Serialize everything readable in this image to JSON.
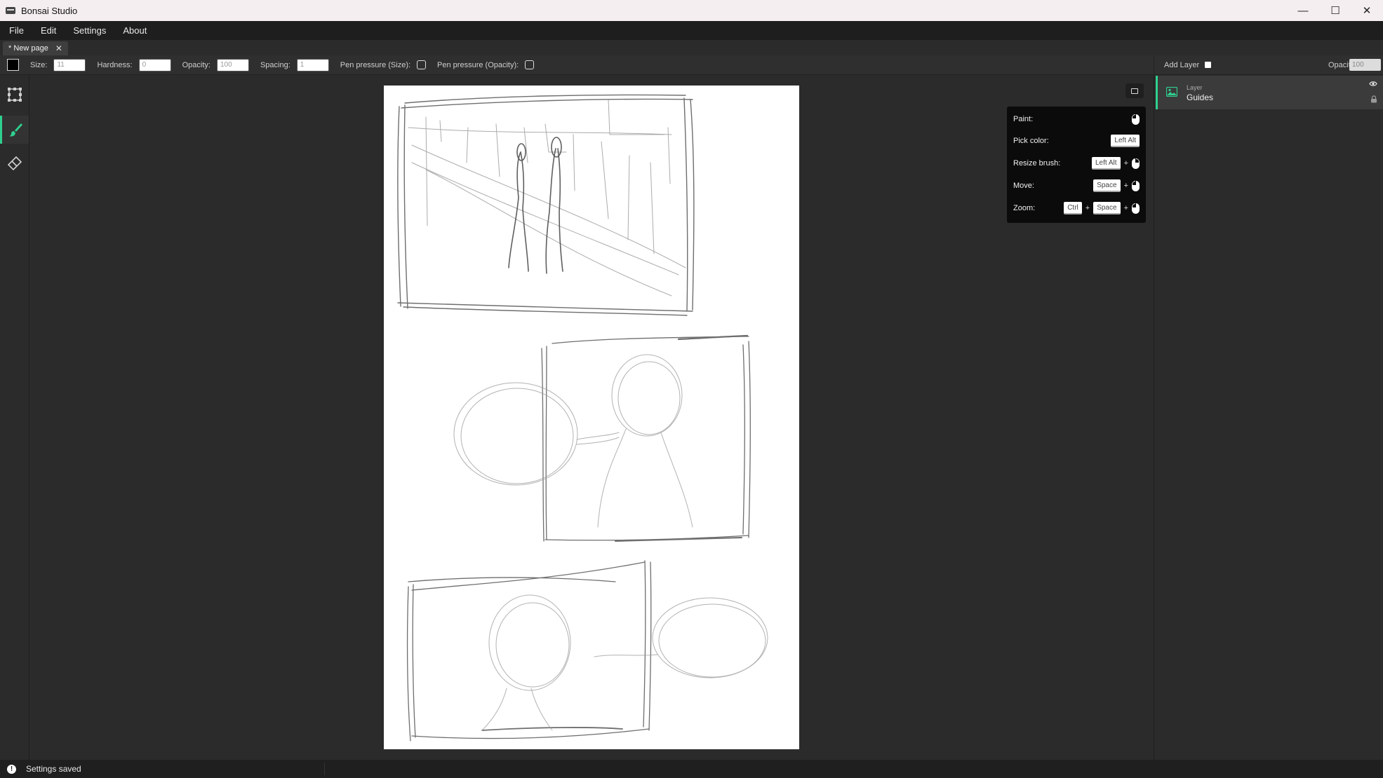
{
  "window": {
    "title": "Bonsai Studio",
    "minimize": "—",
    "maximize": "☐",
    "close": "✕"
  },
  "menu": {
    "items": [
      "File",
      "Edit",
      "Settings",
      "About"
    ]
  },
  "tabs": [
    {
      "label": "* New page",
      "close": "✕"
    }
  ],
  "brush_toolbar": {
    "color": "#000000",
    "size_label": "Size:",
    "size_value": "11",
    "hardness_label": "Hardness:",
    "hardness_value": "0",
    "opacity_label": "Opacity:",
    "opacity_value": "100",
    "spacing_label": "Spacing:",
    "spacing_value": "1",
    "pen_size_label": "Pen pressure (Size):",
    "pen_opacity_label": "Pen pressure (Opacity):"
  },
  "layers_toolbar": {
    "add_layer_label": "Add Layer",
    "opacity_label": "Opacity:",
    "opacity_value": "100"
  },
  "tools": [
    {
      "name": "transform-tool",
      "icon": "grid-move-icon",
      "active": false
    },
    {
      "name": "brush-tool",
      "icon": "brush-icon",
      "active": true
    },
    {
      "name": "eraser-tool",
      "icon": "eraser-icon",
      "active": false
    }
  ],
  "shortcuts": {
    "paint_label": "Paint:",
    "pick_color_label": "Pick color:",
    "pick_color_key": "Left Alt",
    "resize_label": "Resize brush:",
    "resize_key": "Left Alt",
    "move_label": "Move:",
    "move_key": "Space",
    "zoom_label": "Zoom:",
    "zoom_key1": "Ctrl",
    "zoom_key2": "Space",
    "plus": "+"
  },
  "layers": [
    {
      "type": "Layer",
      "name": "Guides",
      "visible": true,
      "locked": true
    }
  ],
  "status": {
    "icon": "!",
    "message": "Settings saved"
  },
  "colors": {
    "accent": "#2fd08f",
    "background": "#2b2b2b",
    "page": "#ffffff"
  }
}
